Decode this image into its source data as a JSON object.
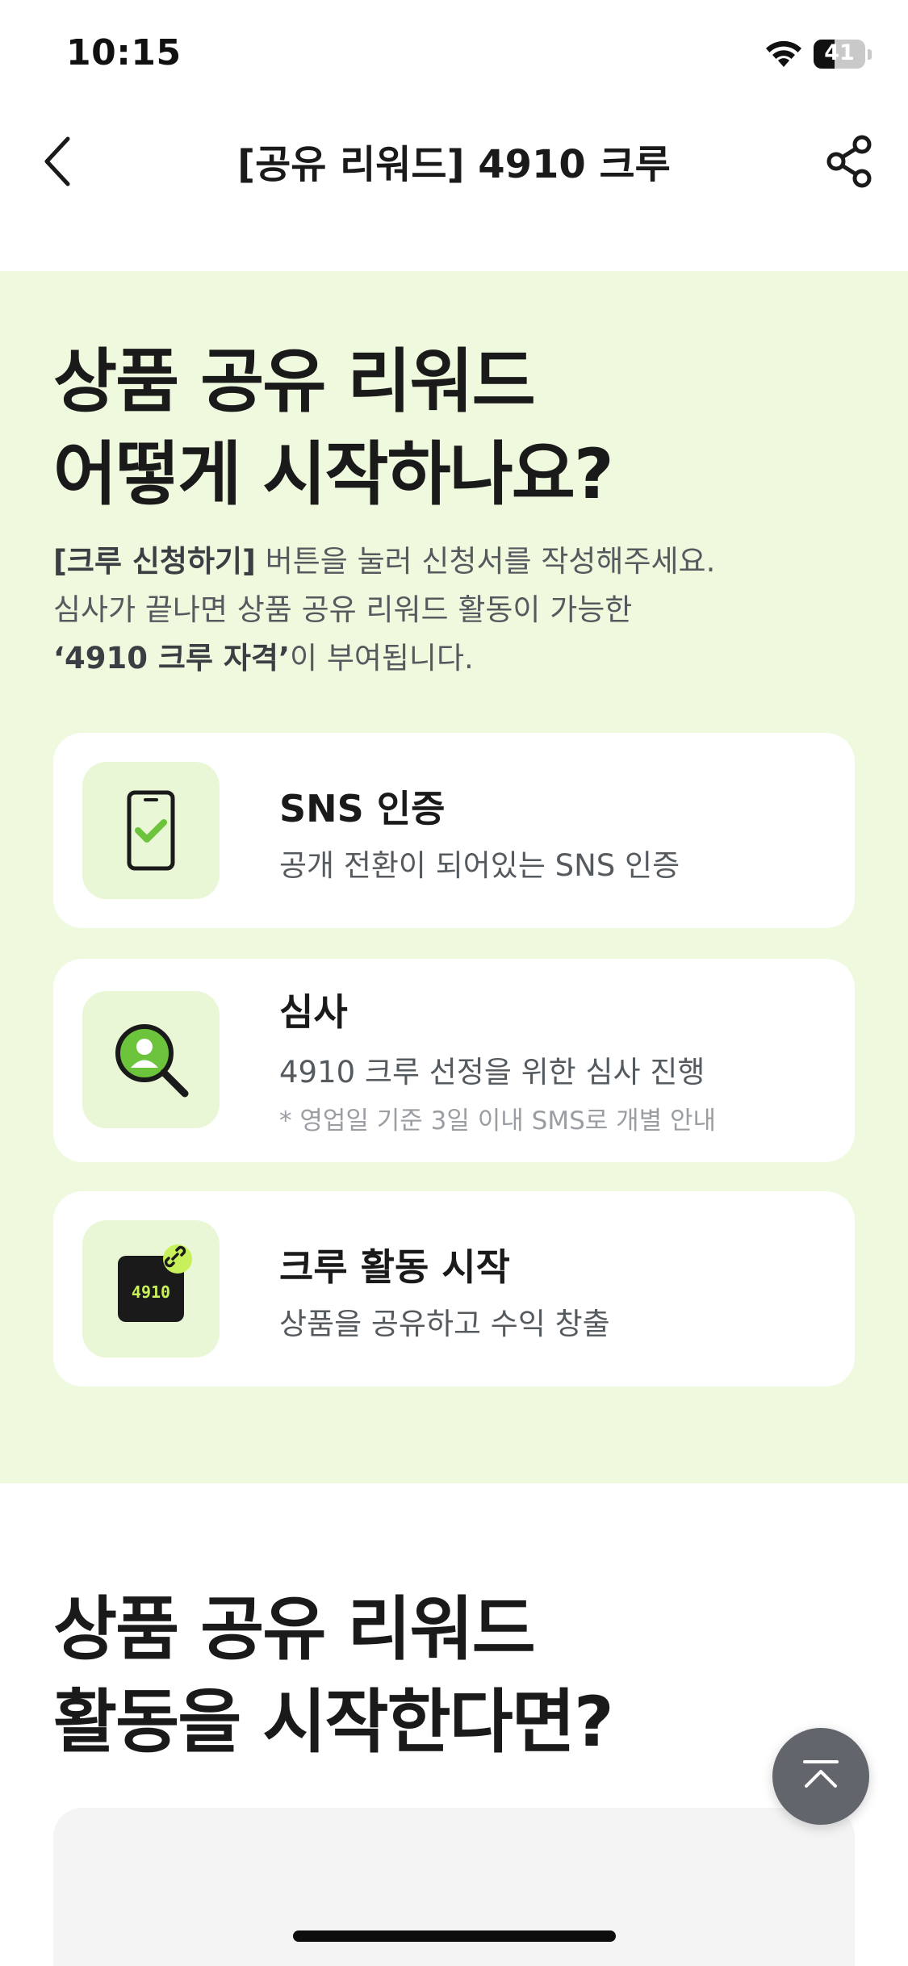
{
  "status_bar": {
    "time": "10:15",
    "battery_level": "41",
    "battery_fraction": 0.41
  },
  "nav": {
    "title": "[공유 리워드] 4910 크루",
    "back_icon": "chevron-left-icon",
    "share_icon": "share-icon"
  },
  "hero": {
    "title_line1": "상품 공유 리워드",
    "title_line2": "어떻게 시작하나요?",
    "desc_line1_strong": "[크루 신청하기]",
    "desc_line1_rest": " 버튼을 눌러 신청서를 작성해주세요.",
    "desc_line2": "심사가 끝나면 상품 공유 리워드 활동이 가능한",
    "desc_line3_strong": "‘4910 크루 자격’",
    "desc_line3_rest": "이 부여됩니다."
  },
  "steps": [
    {
      "icon": "phone-check-icon",
      "title": "SNS 인증",
      "desc": "공개 전환이 되어있는 SNS 인증"
    },
    {
      "icon": "magnifier-user-icon",
      "title": "심사",
      "desc": "4910 크루 선정을 위한 심사 진행",
      "note": "* 영업일 기준 3일 이내 SMS로 개별 안내"
    },
    {
      "icon": "crew-link-icon",
      "badge_text": "4910",
      "title": "크루 활동 시작",
      "desc": "상품을 공유하고 수익 창출"
    }
  ],
  "section2": {
    "title_line1": "상품 공유 리워드",
    "title_line2": "활동을 시작한다면?"
  },
  "colors": {
    "section_bg": "#eef9de",
    "icon_box_bg": "#eaf7d7",
    "accent_green": "#6cc43c",
    "accent_lime": "#c7f05a"
  },
  "scroll_top_icon": "arrow-up-to-top-icon"
}
